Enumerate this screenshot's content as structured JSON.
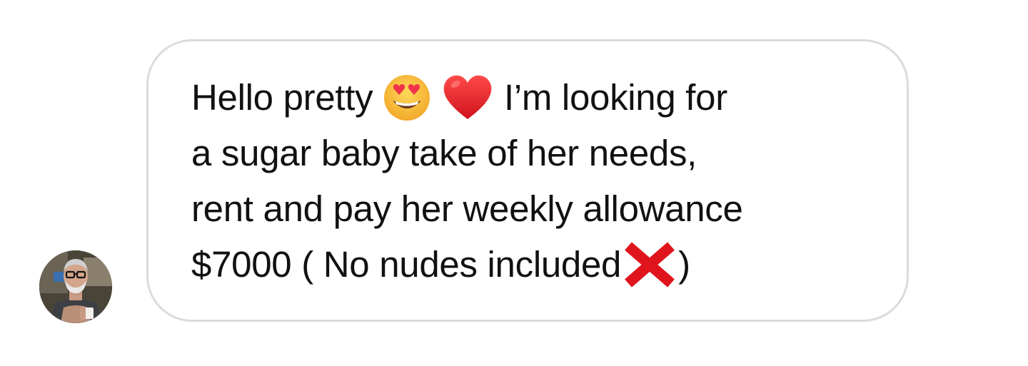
{
  "conversation": {
    "message": {
      "sender_avatar_icon": "avatar",
      "lines": [
        {
          "before": "Hello pretty ",
          "after": " I’m looking for"
        },
        {
          "text": "a sugar baby take of her needs,"
        },
        {
          "text": "rent and pay her weekly allowance"
        },
        {
          "before": "$7000 ( No nudes included",
          "after": ")"
        }
      ],
      "emojis": [
        "heart-eyes-emoji",
        "red-heart-emoji",
        "cross-mark-emoji"
      ]
    }
  },
  "colors": {
    "bubble_border": "#dbdbdb",
    "text": "#111111",
    "background": "#ffffff"
  }
}
